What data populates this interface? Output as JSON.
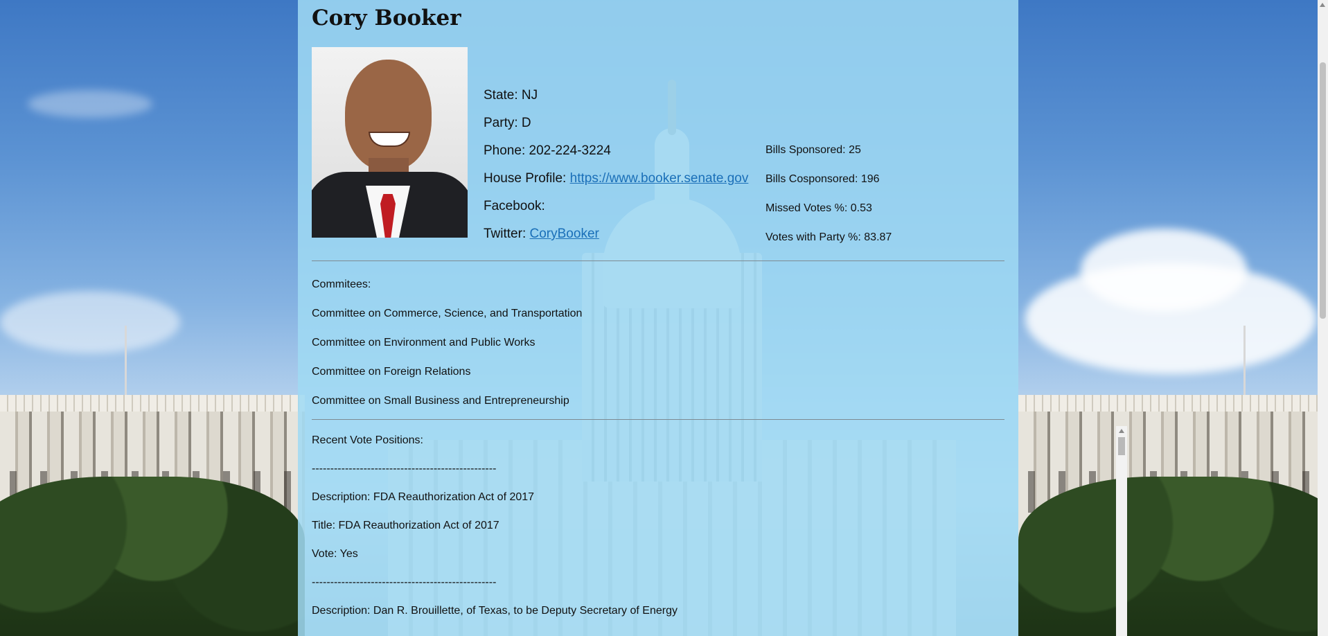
{
  "senator": {
    "name": "Cory Booker",
    "state": "State: NJ",
    "party": "Party: D",
    "phone": "Phone: 202-224-3224",
    "house_profile_label": "House Profile:",
    "house_profile_url": "https://www.booker.senate.gov",
    "facebook_label": "Facebook:",
    "twitter_label": "Twitter:",
    "twitter_handle": "CoryBooker"
  },
  "stats": {
    "bills_sponsored": "Bills Sponsored: 25",
    "bills_cosponsored": "Bills Cosponsored: 196",
    "missed_votes": "Missed Votes %: 0.53",
    "votes_with_party": "Votes with Party %: 83.87"
  },
  "committees": {
    "heading": "Commitees:",
    "items": [
      "Committee on Commerce, Science, and Transportation",
      "Committee on Environment and Public Works",
      "Committee on Foreign Relations",
      "Committee on Small Business and Entrepreneurship"
    ]
  },
  "votes": {
    "heading": "Recent Vote Positions:",
    "separator": "--------------------------------------------------",
    "items": [
      {
        "description": "Description: FDA Reauthorization Act of 2017",
        "title": "Title: FDA Reauthorization Act of 2017",
        "vote": "Vote: Yes"
      },
      {
        "description": "Description: Dan R. Brouillette, of Texas, to be Deputy Secretary of Energy"
      }
    ]
  },
  "colors": {
    "panel": "#a0daf3",
    "link": "#1a6fb8"
  }
}
